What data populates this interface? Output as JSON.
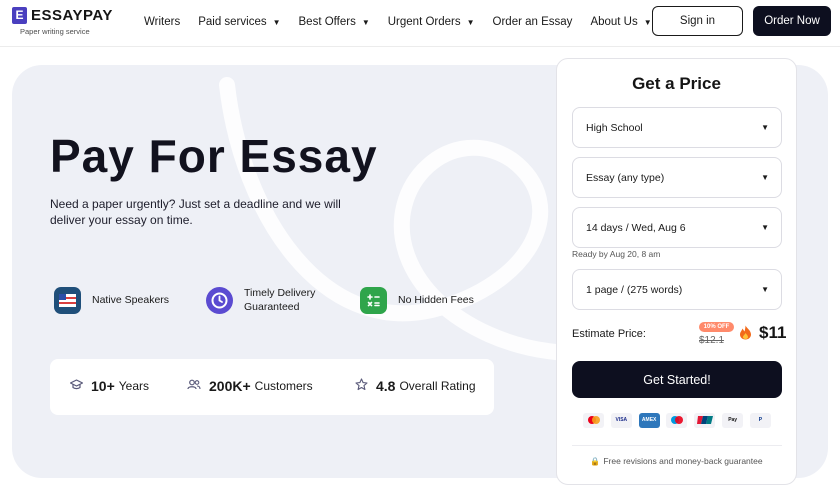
{
  "brand": {
    "name": "ESSAYPAY",
    "mark": "E",
    "tagline": "Paper writing service"
  },
  "nav": [
    {
      "label": "Writers",
      "dropdown": false
    },
    {
      "label": "Paid services",
      "dropdown": true
    },
    {
      "label": "Best Offers",
      "dropdown": true
    },
    {
      "label": "Urgent Orders",
      "dropdown": true
    },
    {
      "label": "Order an Essay",
      "dropdown": false
    },
    {
      "label": "About Us",
      "dropdown": true
    }
  ],
  "header": {
    "sign_in": "Sign in",
    "order_now": "Order Now"
  },
  "hero": {
    "title": "Pay For Essay",
    "description": "Need a paper urgently? Just set a deadline and we will deliver your essay on time.",
    "features": [
      {
        "label": "Native Speakers",
        "icon": "flag-icon",
        "color": "#1f4f7a"
      },
      {
        "label": "Timely Delivery Guaranteed",
        "icon": "clock-icon",
        "color": "#5b4bd1"
      },
      {
        "label": "No Hidden Fees",
        "icon": "calculator-icon",
        "color": "#2fa54b"
      }
    ],
    "stats": [
      {
        "icon": "graduation-cap-icon",
        "number": "10+",
        "label": "Years"
      },
      {
        "icon": "users-icon",
        "number": "200K+",
        "label": "Customers"
      },
      {
        "icon": "star-icon",
        "number": "4.8",
        "label": "Overall Rating"
      }
    ]
  },
  "price_card": {
    "title": "Get a Price",
    "academic_level": "High School",
    "paper_type": "Essay (any type)",
    "deadline": "14 days / Wed, Aug 6",
    "ready_by": "Ready by Aug 20, 8 am",
    "pages": "1 page / (275 words)",
    "estimate_label": "Estimate Price:",
    "discount_badge": "10% OFF",
    "old_price": "$12.1",
    "new_price": "$11",
    "cta": "Get Started!",
    "payments": [
      "mastercard-icon",
      "visa-icon",
      "amex-icon",
      "maestro-icon",
      "unionpay-icon",
      "apple-pay-icon",
      "paypal-icon"
    ],
    "guarantee": "Free revisions and money-back guarantee"
  },
  "colors": {
    "primary_dark": "#0d0f1f",
    "hero_bg": "#eef0f6",
    "brand_purple": "#4a3fbf",
    "badge": "#ff8a6b"
  }
}
